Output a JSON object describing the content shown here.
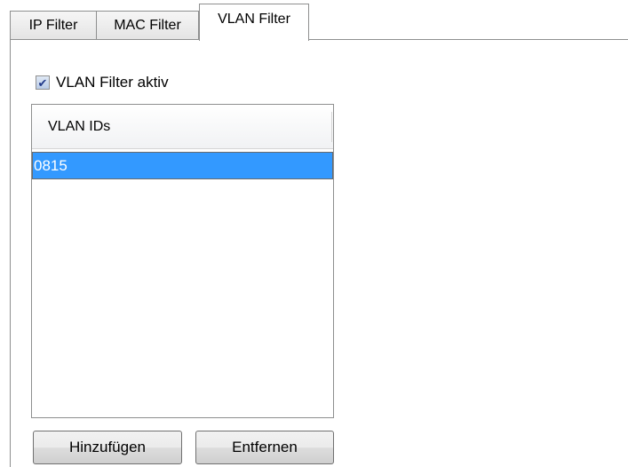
{
  "tabs": [
    {
      "label": "IP Filter",
      "active": false
    },
    {
      "label": "MAC Filter",
      "active": false
    },
    {
      "label": "VLAN Filter",
      "active": true
    }
  ],
  "vlan_filter": {
    "active_checkbox": {
      "label": "VLAN Filter aktiv",
      "checked": true,
      "check_glyph": "✔"
    },
    "list": {
      "column_header": "VLAN IDs",
      "rows": [
        "0815"
      ],
      "selected_index": 0
    },
    "buttons": {
      "add_label": "Hinzufügen",
      "remove_label": "Entfernen"
    }
  },
  "colors": {
    "selection": "#3399ff",
    "border": "#8e8f8f"
  }
}
